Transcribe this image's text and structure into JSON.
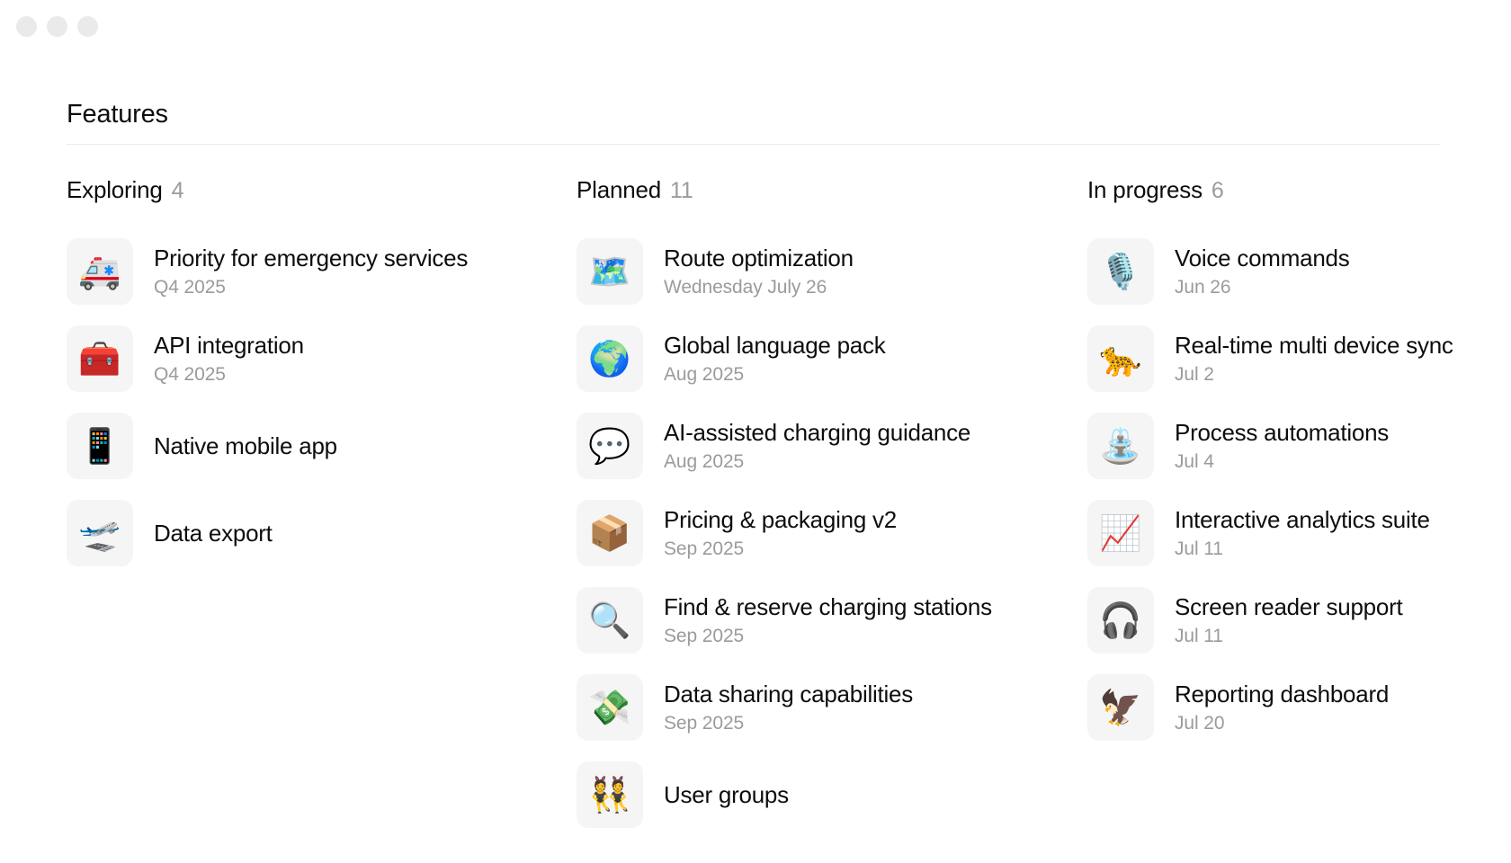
{
  "window": {
    "dots": [
      "close-dot",
      "minimize-dot",
      "maximize-dot"
    ]
  },
  "header": {
    "title": "Features"
  },
  "board": {
    "columns": [
      {
        "name": "Exploring",
        "count": "4",
        "items": [
          {
            "icon": "🚑",
            "icon_name": "ambulance-emoji",
            "title": "Priority for emergency services",
            "date": "Q4 2025"
          },
          {
            "icon": "🧰",
            "icon_name": "toolbox-emoji",
            "title": "API integration",
            "date": "Q4 2025"
          },
          {
            "icon": "📱",
            "icon_name": "mobile-phone-emoji",
            "title": "Native mobile app",
            "date": ""
          },
          {
            "icon": "🛫",
            "icon_name": "airplane-departure-emoji",
            "title": "Data export",
            "date": ""
          }
        ]
      },
      {
        "name": "Planned",
        "count": "11",
        "items": [
          {
            "icon": "🗺️",
            "icon_name": "world-map-emoji",
            "title": "Route optimization",
            "date": "Wednesday July 26"
          },
          {
            "icon": "🌍",
            "icon_name": "globe-europe-africa-emoji",
            "title": "Global language pack",
            "date": "Aug 2025"
          },
          {
            "icon": "💬",
            "icon_name": "speech-balloon-emoji",
            "title": "AI-assisted charging guidance",
            "date": "Aug 2025"
          },
          {
            "icon": "📦",
            "icon_name": "package-emoji",
            "title": "Pricing & packaging v2",
            "date": "Sep 2025"
          },
          {
            "icon": "🔍",
            "icon_name": "magnifying-glass-emoji",
            "title": "Find & reserve charging stations",
            "date": "Sep 2025"
          },
          {
            "icon": "💸",
            "icon_name": "money-with-wings-emoji",
            "title": "Data sharing capabilities",
            "date": "Sep 2025"
          },
          {
            "icon": "👯",
            "icon_name": "people-with-bunny-ears-emoji",
            "title": "User groups",
            "date": ""
          }
        ]
      },
      {
        "name": "In progress",
        "count": "6",
        "items": [
          {
            "icon": "🎙️",
            "icon_name": "studio-microphone-emoji",
            "title": "Voice commands",
            "date": "Jun 26"
          },
          {
            "icon": "🐆",
            "icon_name": "leopard-emoji",
            "title": "Real-time multi device sync",
            "date": "Jul 2"
          },
          {
            "icon": "⛲",
            "icon_name": "fountain-emoji",
            "title": "Process automations",
            "date": "Jul 4"
          },
          {
            "icon": "📈",
            "icon_name": "chart-increasing-emoji",
            "title": "Interactive analytics suite",
            "date": "Jul 11"
          },
          {
            "icon": "🎧",
            "icon_name": "headphone-emoji",
            "title": "Screen reader support",
            "date": "Jul 11"
          },
          {
            "icon": "🦅",
            "icon_name": "eagle-emoji",
            "title": "Reporting dashboard",
            "date": "Jul 20"
          }
        ]
      }
    ]
  },
  "colors": {
    "background": "#ffffff",
    "text_primary": "#0d0d0d",
    "text_muted": "#9b9b9b",
    "tile_background": "#f5f5f5",
    "divider": "#ececec",
    "window_dot": "#eaeaea"
  }
}
